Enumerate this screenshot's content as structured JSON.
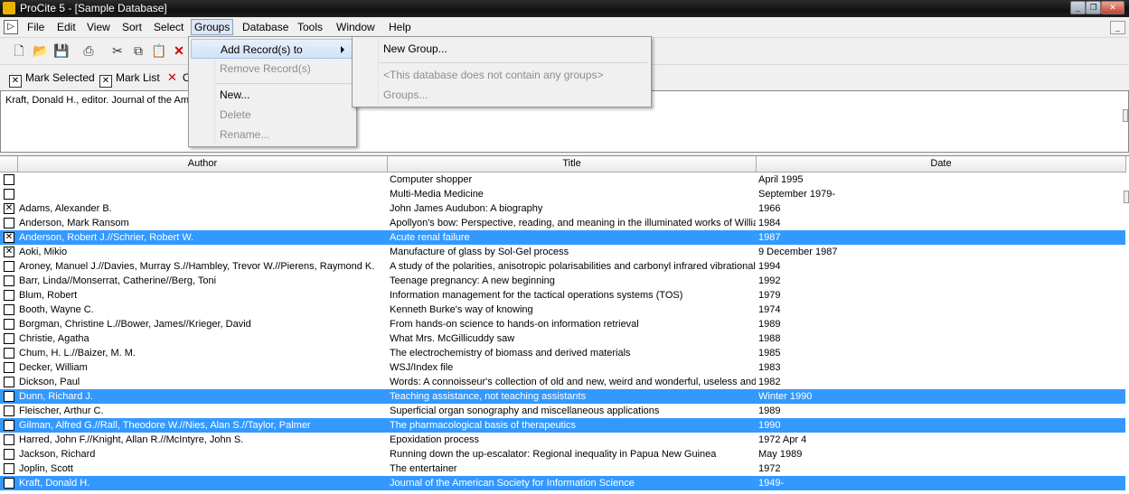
{
  "window": {
    "title": "ProCite 5 - [Sample Database]"
  },
  "menubar": {
    "items": [
      "File",
      "Edit",
      "View",
      "Sort",
      "Select",
      "Groups",
      "Database",
      "Tools",
      "Window",
      "Help"
    ]
  },
  "markbar": {
    "mark_selected": "Mark Selected",
    "mark_list": "Mark List",
    "clear_partial": "C"
  },
  "preview": {
    "text": "Kraft, Donald H., editor. Journal of the Ame"
  },
  "groups_menu": {
    "items": [
      {
        "label": "Add Record(s) to",
        "state": "highlighted",
        "submenu": true
      },
      {
        "label": "Remove Record(s)",
        "state": "disabled"
      },
      {
        "label": "New...",
        "state": "enabled"
      },
      {
        "label": "Delete",
        "state": "disabled"
      },
      {
        "label": "Rename...",
        "state": "disabled"
      }
    ]
  },
  "add_submenu": {
    "items": [
      {
        "label": "New Group...",
        "state": "enabled"
      },
      {
        "label": "<This database does not contain any groups>",
        "state": "disabled"
      },
      {
        "label": "Groups...",
        "state": "disabled"
      }
    ]
  },
  "table": {
    "columns": [
      "Author",
      "Title",
      "Date"
    ],
    "rows": [
      {
        "author": "",
        "title": "Computer shopper",
        "date": "April 1995",
        "checked": false,
        "selected": false
      },
      {
        "author": "",
        "title": "Multi-Media Medicine",
        "date": "September 1979-",
        "checked": false,
        "selected": false
      },
      {
        "author": "Adams, Alexander B.",
        "title": "John James Audubon: A biography",
        "date": "1966",
        "checked": true,
        "selected": false
      },
      {
        "author": "Anderson, Mark Ransom",
        "title": "Apollyon's bow: Perspective, reading, and meaning in the illuminated works of William Blake",
        "date": "1984",
        "checked": false,
        "selected": false
      },
      {
        "author": "Anderson, Robert J.//Schrier, Robert W.",
        "title": "Acute renal failure",
        "date": "1987",
        "checked": true,
        "selected": true
      },
      {
        "author": "Aoki, Mikio",
        "title": "Manufacture of glass by Sol-Gel process",
        "date": "9 December 1987",
        "checked": true,
        "selected": false
      },
      {
        "author": "Aroney, Manuel J.//Davies, Murray S.//Hambley, Trevor W.//Pierens, Raymond K.",
        "title": "A study of the polarities, anisotropic polarisabilities and carbonyl infrared vibrational frequencies",
        "date": "1994",
        "checked": false,
        "selected": false
      },
      {
        "author": "Barr, Linda//Monserrat, Catherine//Berg, Toni",
        "title": "Teenage pregnancy: A new beginning",
        "date": "1992",
        "checked": false,
        "selected": false
      },
      {
        "author": "Blum, Robert",
        "title": "Information management for the tactical operations systems (TOS)",
        "date": "1979",
        "checked": false,
        "selected": false
      },
      {
        "author": "Booth, Wayne C.",
        "title": "Kenneth Burke's way of knowing",
        "date": "1974",
        "checked": false,
        "selected": false
      },
      {
        "author": "Borgman, Christine L.//Bower, James//Krieger, David",
        "title": "From hands-on science to hands-on information retrieval",
        "date": "1989",
        "checked": false,
        "selected": false
      },
      {
        "author": "Christie, Agatha",
        "title": "What Mrs. McGillicuddy saw",
        "date": "1988",
        "checked": false,
        "selected": false
      },
      {
        "author": "Chum, H. L.//Baizer, M. M.",
        "title": "The electrochemistry of biomass and derived materials",
        "date": "1985",
        "checked": false,
        "selected": false
      },
      {
        "author": "Decker, William",
        "title": "WSJ/Index file",
        "date": "1983",
        "checked": false,
        "selected": false
      },
      {
        "author": "Dickson, Paul",
        "title": "Words: A connoisseur's collection of old and new, weird and wonderful, useless and outlandish words",
        "date": "1982",
        "checked": false,
        "selected": false
      },
      {
        "author": "Dunn, Richard J.",
        "title": "Teaching assistance, not teaching assistants",
        "date": "Winter 1990",
        "checked": false,
        "selected": true
      },
      {
        "author": "Fleischer, Arthur C.",
        "title": "Superficial organ sonography and miscellaneous applications",
        "date": "1989",
        "checked": false,
        "selected": false
      },
      {
        "author": "Gilman, Alfred G.//Rall, Theodore W.//Nies, Alan S.//Taylor, Palmer",
        "title": "The pharmacological basis of therapeutics",
        "date": "1990",
        "checked": false,
        "selected": true
      },
      {
        "author": "Harred, John F.//Knight, Allan R.//McIntyre, John S.",
        "title": "Epoxidation process",
        "date": "1972 Apr 4",
        "checked": false,
        "selected": false
      },
      {
        "author": "Jackson, Richard",
        "title": "Running down the up-escalator: Regional inequality in Papua New Guinea",
        "date": "May 1989",
        "checked": false,
        "selected": false
      },
      {
        "author": "Joplin, Scott",
        "title": "The entertainer",
        "date": "1972",
        "checked": false,
        "selected": false
      },
      {
        "author": "Kraft, Donald H.",
        "title": "Journal of the American Society for Information Science",
        "date": "1949-",
        "checked": false,
        "selected": true
      }
    ]
  },
  "colors": {
    "selection": "#3399ff",
    "menu_highlight": "#d2e2f6"
  }
}
